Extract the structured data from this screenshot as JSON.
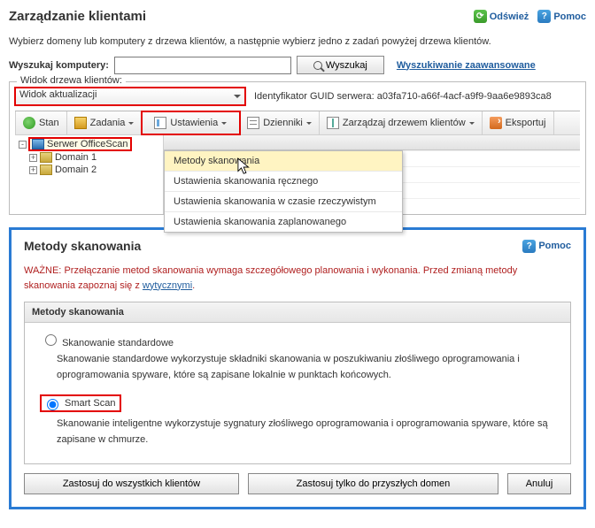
{
  "header": {
    "title": "Zarządzanie klientami",
    "refresh": "Odśwież",
    "help": "Pomoc"
  },
  "instruction": "Wybierz domeny lub komputery z drzewa klientów, a następnie wybierz jedno z zadań powyżej drzewa klientów.",
  "search": {
    "label": "Wyszukaj komputery:",
    "button": "Wyszukaj",
    "advanced": "Wyszukiwanie zaawansowane"
  },
  "treeView": {
    "panelLabel": "Widok drzewa klientów:",
    "selected": "Widok aktualizacji",
    "guidLabel": "Identyfikator GUID serwera:",
    "guid": "a03fa710-a66f-4acf-a9f9-9aa6e9893ca8"
  },
  "toolbar": {
    "status": "Stan",
    "tasks": "Zadania",
    "settings": "Ustawienia",
    "logs": "Dzienniki",
    "manageTree": "Zarządzaj drzewem klientów",
    "export": "Eksportuj"
  },
  "tree": {
    "root": "Serwer OfficeScan",
    "domain1": "Domain 1",
    "domain2": "Domain 2"
  },
  "settingsMenu": {
    "items": [
      "Metody skanowania",
      "Ustawienia skanowania ręcznego",
      "Ustawienia skanowania w czasie rzeczywistym",
      "Ustawienia skanowania zaplanowanego"
    ]
  },
  "panel": {
    "title": "Metody skanowania",
    "help": "Pomoc",
    "warningLabel": "WAŻNE:",
    "warningText": "Przełączanie metod skanowania wymaga szczegółowego planowania i wykonania. Przed zmianą metody skanowania zapoznaj się z ",
    "warningLink": "wytycznymi",
    "groupTitle": "Metody skanowania",
    "opt1Label": "Skanowanie standardowe",
    "opt1Desc": "Skanowanie standardowe wykorzystuje składniki skanowania w poszukiwaniu złośliwego oprogramowania i oprogramowania spyware, które są zapisane lokalnie w punktach końcowych.",
    "opt2Label": "Smart Scan",
    "opt2Desc": "Skanowanie inteligentne wykorzystuje sygnatury złośliwego oprogramowania i oprogramowania spyware, które są zapisane w chmurze.",
    "applyAll": "Zastosuj do wszystkich klientów",
    "applyFuture": "Zastosuj tylko do przyszłych domen",
    "cancel": "Anuluj"
  }
}
